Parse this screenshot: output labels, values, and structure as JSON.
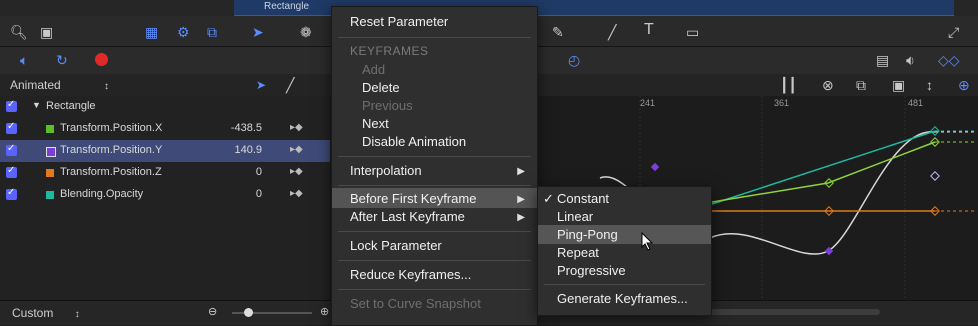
{
  "header": {
    "track_label": "Rectangle",
    "animated_label": "Animated"
  },
  "list": {
    "group": "Rectangle",
    "rows": [
      {
        "label": "Transform.Position.X",
        "value": "-438.5",
        "color": "#5cbf2a"
      },
      {
        "label": "Transform.Position.Y",
        "value": "140.9",
        "color": "#7b3fd6"
      },
      {
        "label": "Transform.Position.Z",
        "value": "0",
        "color": "#e07a1a"
      },
      {
        "label": "Blending.Opacity",
        "value": "0",
        "color": "#1fb8a0"
      }
    ]
  },
  "ruler": {
    "ticks": [
      "241",
      "361",
      "481"
    ]
  },
  "bottom": {
    "custom_label": "Custom"
  },
  "menu": {
    "reset": "Reset Parameter",
    "keyframes_header": "KEYFRAMES",
    "add": "Add",
    "delete": "Delete",
    "previous": "Previous",
    "next": "Next",
    "disable_animation": "Disable Animation",
    "interpolation": "Interpolation",
    "before_first": "Before First Keyframe",
    "after_last": "After Last Keyframe",
    "lock": "Lock Parameter",
    "reduce": "Reduce Keyframes...",
    "set_curve": "Set to Curve Snapshot"
  },
  "submenu": {
    "constant": "Constant",
    "linear": "Linear",
    "ping_pong": "Ping-Pong",
    "repeat": "Repeat",
    "progressive": "Progressive",
    "generate": "Generate Keyframes..."
  }
}
